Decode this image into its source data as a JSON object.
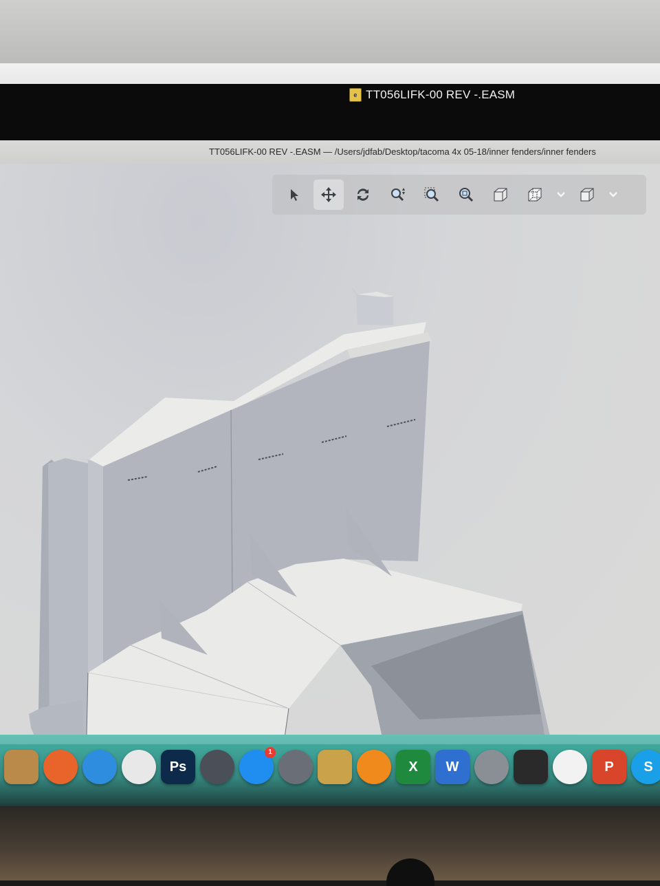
{
  "window": {
    "title": "TT056LIFK-00 REV -.EASM",
    "doc_icon_text": "e",
    "path": "TT056LIFK-00 REV -.EASM  —  /Users/jdfab/Desktop/tacoma 4x 05-18/inner fenders/inner fenders"
  },
  "toolbar": {
    "tools": [
      {
        "name": "select-tool",
        "icon": "pointer-icon",
        "active": false
      },
      {
        "name": "pan-tool",
        "icon": "move-icon",
        "active": true
      },
      {
        "name": "rotate-tool",
        "icon": "rotate-icon",
        "active": false
      },
      {
        "name": "zoom-tool",
        "icon": "zoom-updown-icon",
        "active": false
      },
      {
        "name": "zoom-box-tool",
        "icon": "zoom-box-icon",
        "active": false
      },
      {
        "name": "zoom-fit-tool",
        "icon": "zoom-fit-icon",
        "active": false
      },
      {
        "name": "shaded-view",
        "icon": "cube-shaded-icon",
        "active": false
      },
      {
        "name": "view-orientation",
        "icon": "cube-wire-icon",
        "active": false
      },
      {
        "name": "display-style",
        "icon": "cube-solid-icon",
        "active": false
      }
    ]
  },
  "dock": {
    "apps": [
      {
        "name": "notes-folder",
        "label": "",
        "color": "#b98a4a"
      },
      {
        "name": "firefox",
        "label": "",
        "color": "#e8642a"
      },
      {
        "name": "safari",
        "label": "",
        "color": "#2f8de0"
      },
      {
        "name": "chrome",
        "label": "",
        "color": "#e8e8e8"
      },
      {
        "name": "photoshop",
        "label": "Ps",
        "color": "#0d2a4a"
      },
      {
        "name": "quicktime",
        "label": "",
        "color": "#4b4f58"
      },
      {
        "name": "app-store",
        "label": "",
        "color": "#1f8ef0",
        "badge": "1"
      },
      {
        "name": "launchpad",
        "label": "",
        "color": "#6a6f77"
      },
      {
        "name": "transmit",
        "label": "",
        "color": "#c9a24a"
      },
      {
        "name": "books",
        "label": "",
        "color": "#f08a1c"
      },
      {
        "name": "excel",
        "label": "X",
        "color": "#1f8a3d"
      },
      {
        "name": "word",
        "label": "W",
        "color": "#2f6fd0"
      },
      {
        "name": "system-preferences",
        "label": "",
        "color": "#8a8f96"
      },
      {
        "name": "display-manager",
        "label": "",
        "color": "#2a2a2a"
      },
      {
        "name": "itunes",
        "label": "",
        "color": "#f2f2f2"
      },
      {
        "name": "powerpoint",
        "label": "P",
        "color": "#d8452a"
      },
      {
        "name": "skype",
        "label": "S",
        "color": "#1aa0e8"
      }
    ]
  },
  "colors": {
    "viewport_bg": "#d6d7d9",
    "part_light": "#ededeb",
    "part_mid": "#b9bcc4",
    "part_dark": "#8e929b"
  }
}
